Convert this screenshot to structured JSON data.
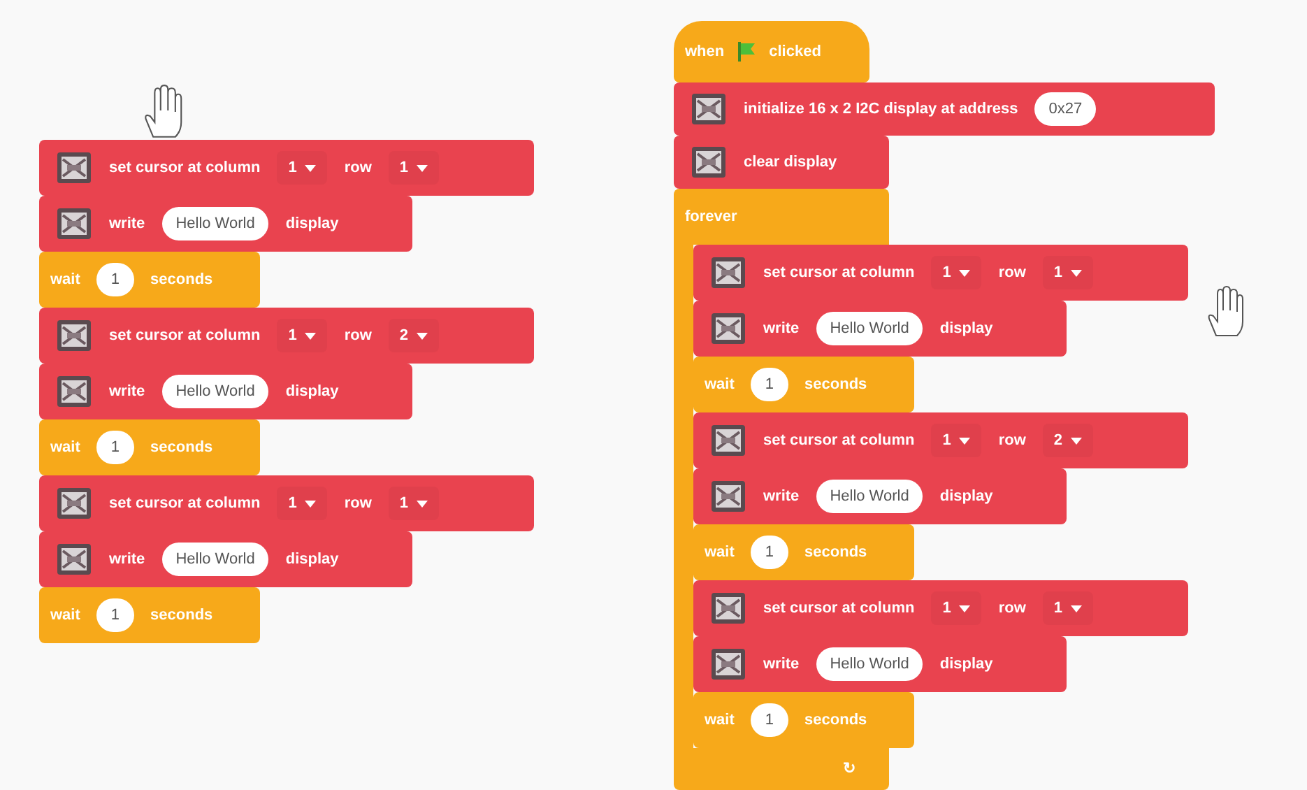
{
  "left_script": [
    {
      "kind": "set_cursor",
      "label": "set cursor at column",
      "column": "1",
      "row_label": "row",
      "row": "1"
    },
    {
      "kind": "write",
      "label": "write",
      "text": "Hello World",
      "suffix": "display"
    },
    {
      "kind": "wait",
      "label": "wait",
      "value": "1",
      "suffix": "seconds"
    },
    {
      "kind": "set_cursor",
      "label": "set cursor at column",
      "column": "1",
      "row_label": "row",
      "row": "2"
    },
    {
      "kind": "write",
      "label": "write",
      "text": "Hello World",
      "suffix": "display"
    },
    {
      "kind": "wait",
      "label": "wait",
      "value": "1",
      "suffix": "seconds"
    },
    {
      "kind": "set_cursor",
      "label": "set cursor at column",
      "column": "1",
      "row_label": "row",
      "row": "1"
    },
    {
      "kind": "write",
      "label": "write",
      "text": "Hello World",
      "suffix": "display"
    },
    {
      "kind": "wait",
      "label": "wait",
      "value": "1",
      "suffix": "seconds"
    }
  ],
  "right_script": {
    "hat": {
      "before": "when",
      "after": "clicked"
    },
    "blocks": [
      {
        "kind": "init",
        "label": "initialize 16 x 2 I2C display at address",
        "value": "0x27"
      },
      {
        "kind": "clear",
        "label": "clear display"
      }
    ],
    "forever": {
      "label": "forever",
      "loop_mark": "↻",
      "children": [
        {
          "kind": "set_cursor",
          "label": "set cursor at column",
          "column": "1",
          "row_label": "row",
          "row": "1"
        },
        {
          "kind": "write",
          "label": "write",
          "text": "Hello World",
          "suffix": "display"
        },
        {
          "kind": "wait",
          "label": "wait",
          "value": "1",
          "suffix": "seconds"
        },
        {
          "kind": "set_cursor",
          "label": "set cursor at column",
          "column": "1",
          "row_label": "row",
          "row": "2"
        },
        {
          "kind": "write",
          "label": "write",
          "text": "Hello World",
          "suffix": "display"
        },
        {
          "kind": "wait",
          "label": "wait",
          "value": "1",
          "suffix": "seconds"
        },
        {
          "kind": "set_cursor",
          "label": "set cursor at column",
          "column": "1",
          "row_label": "row",
          "row": "1"
        },
        {
          "kind": "write",
          "label": "write",
          "text": "Hello World",
          "suffix": "display"
        },
        {
          "kind": "wait",
          "label": "wait",
          "value": "1",
          "suffix": "seconds"
        }
      ]
    }
  }
}
